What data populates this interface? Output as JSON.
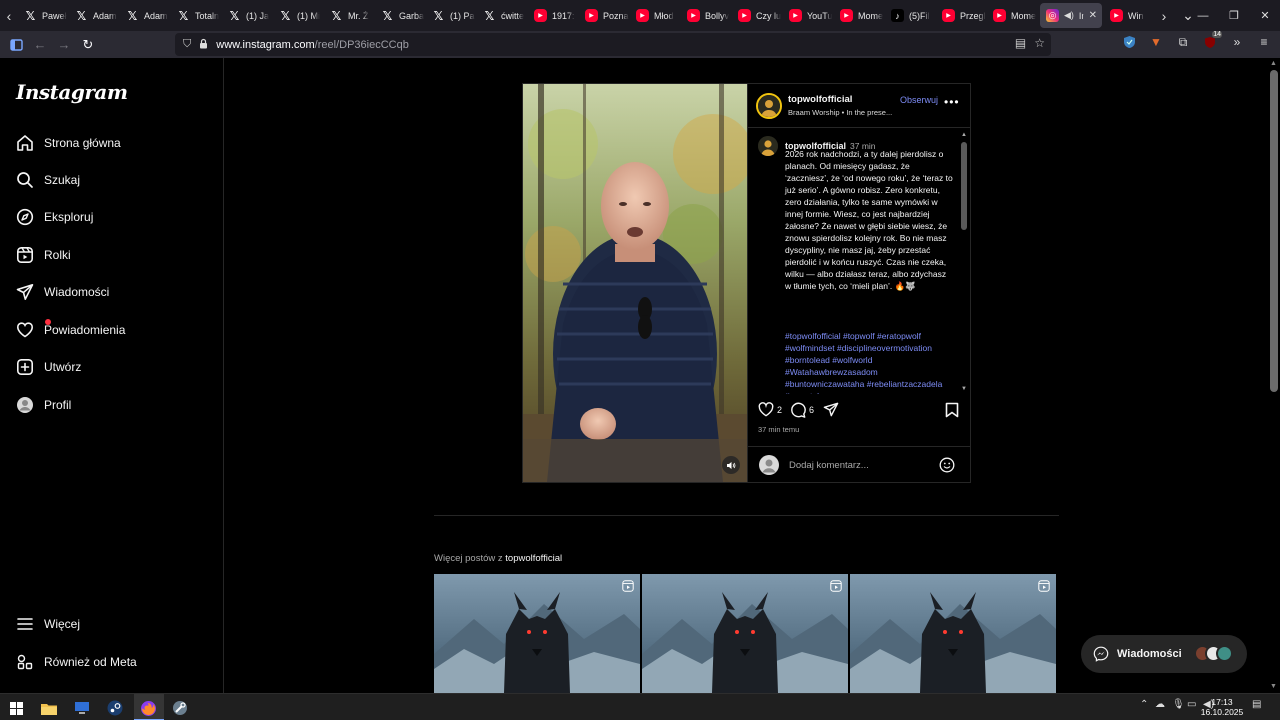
{
  "browser": {
    "tabs": [
      {
        "label": "Paweł",
        "icon": "x"
      },
      {
        "label": "Adam",
        "icon": "x"
      },
      {
        "label": "Adam",
        "icon": "x"
      },
      {
        "label": "Totaln",
        "icon": "x"
      },
      {
        "label": "(1) Ja",
        "icon": "x"
      },
      {
        "label": "(1) Mi",
        "icon": "x"
      },
      {
        "label": "Mr. Ż",
        "icon": "x"
      },
      {
        "label": "Garba",
        "icon": "x"
      },
      {
        "label": "(1) Pa",
        "icon": "x"
      },
      {
        "label": "ćwitte",
        "icon": "x"
      },
      {
        "label": "1917:",
        "icon": "yt"
      },
      {
        "label": "Pozna",
        "icon": "yt"
      },
      {
        "label": "Młod",
        "icon": "yt"
      },
      {
        "label": "Bollyv",
        "icon": "yt"
      },
      {
        "label": "Czy lu",
        "icon": "yt"
      },
      {
        "label": "YouTu",
        "icon": "yt"
      },
      {
        "label": "Mome",
        "icon": "yt"
      },
      {
        "label": "(5)Fil",
        "icon": "tt"
      },
      {
        "label": "Przegl",
        "icon": "yt"
      },
      {
        "label": "Mome",
        "icon": "yt"
      }
    ],
    "active_tab": {
      "label": "Inst",
      "icon": "ig"
    },
    "after_tab": {
      "label": "Win",
      "icon": "fx"
    },
    "url_host": "www.instagram.com",
    "url_path": "/reel/DP36iecCCqb",
    "extension_badge": "14"
  },
  "sidebar": {
    "logo": "Instagram",
    "items": [
      {
        "label": "Strona główna",
        "icon": "home-icon"
      },
      {
        "label": "Szukaj",
        "icon": "search-icon"
      },
      {
        "label": "Eksploruj",
        "icon": "compass-icon"
      },
      {
        "label": "Rolki",
        "icon": "reels-icon"
      },
      {
        "label": "Wiadomości",
        "icon": "send-icon"
      },
      {
        "label": "Powiadomienia",
        "icon": "heart-icon"
      },
      {
        "label": "Utwórz",
        "icon": "plus-square-icon"
      },
      {
        "label": "Profil",
        "icon": "profile-icon"
      }
    ],
    "more": "Więcej",
    "meta": "Również od Meta"
  },
  "post": {
    "username": "topwolfofficial",
    "follow": "Obserwuj",
    "music": "Braam Worship • In the prese...",
    "caption_user": "topwolfofficial",
    "caption_time": "37 min",
    "caption_text": "2026 rok nadchodzi, a ty dalej pierdolisz o planach. Od miesięcy gadasz, że ‘zaczniesz’, że ‘od nowego roku’, że ‘teraz to już serio’. A gówno robisz. Zero konkretu, zero działania, tylko te same wymówki w innej formie. Wiesz, co jest najbardziej żałosne? Że nawet w głębi siebie wiesz, że znowu spierdolisz kolejny rok. Bo nie masz dyscypliny, nie masz jaj, żeby przestać pierdolić i w końcu ruszyć. Czas nie czeka, wilku — albo działasz teraz, albo zdychasz w tłumie tych, co ‘mieli plan’. 🔥🐺",
    "hashtags": "#topwolfofficial #topwolf #eratopwolf #wolfmindset #disciplineovermotivation #borntolead #wolfworld #Watahawbrewzasadom #buntowniczawataha #rebeliantzaczadela #nowataha",
    "likes": "2",
    "comments": "6",
    "posted": "37 min temu",
    "comment_placeholder": "Dodaj komentarz..."
  },
  "more_posts": {
    "prefix": "Więcej postów z ",
    "user": "topwolfofficial"
  },
  "messages_pill": "Wiadomości",
  "taskbar": {
    "time": "17:13",
    "date": "16.10.2025"
  }
}
